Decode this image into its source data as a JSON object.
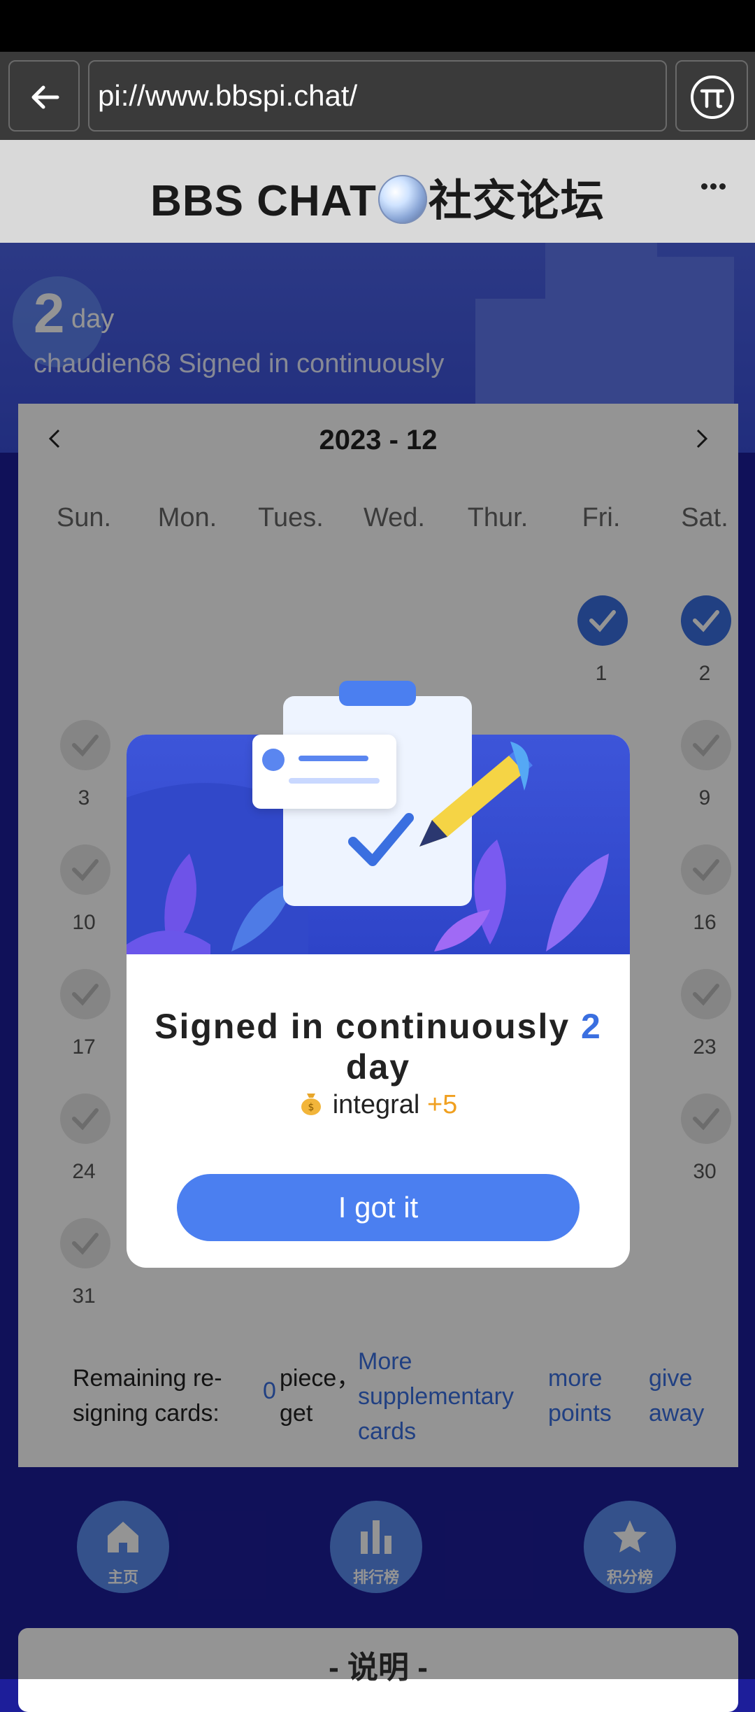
{
  "browser": {
    "url": "pi://www.bbspi.chat/"
  },
  "site": {
    "title_left": "BBS CHAT",
    "title_right": "社交论坛"
  },
  "hero": {
    "streak_days": "2",
    "streak_unit": "day",
    "streak_text": "chaudien68 Signed in continuously"
  },
  "calendar": {
    "month_label": "2023 - 12",
    "weekdays": [
      "Sun.",
      "Mon.",
      "Tues.",
      "Wed.",
      "Thur.",
      "Fri.",
      "Sat."
    ],
    "days": {
      "d1": "1",
      "d2": "2",
      "d3": "3",
      "d9": "9",
      "d10": "10",
      "d16": "16",
      "d17": "17",
      "d23": "23",
      "d24": "24",
      "d30": "30",
      "d31": "31"
    },
    "footer": {
      "remaining_label": "Remaining re-signing cards:",
      "count": "0",
      "piece_get": "piece，get",
      "more_cards": "More supplementary cards",
      "more_points": "more points",
      "give_away": "give away"
    }
  },
  "modal": {
    "title_prefix": "Signed in continuously",
    "title_days": "2",
    "title_suffix": "day",
    "reward_label": "integral",
    "reward_value": "+5",
    "button_label": "I got it"
  },
  "nav": {
    "home": "主页",
    "ranking": "排行榜",
    "points_ranking": "积分榜"
  },
  "explain": {
    "title": "- 说明 -"
  },
  "colors": {
    "accent": "#4b7ff0",
    "highlight": "#f0a020"
  }
}
